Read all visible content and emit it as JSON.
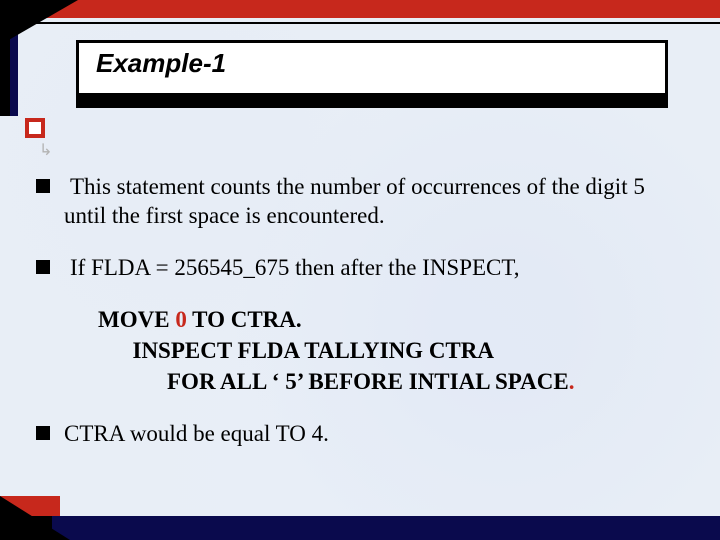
{
  "title": "Example-1",
  "bullets": {
    "b1": "This statement counts the number of occurrences of the digit 5 until the first space is encountered.",
    "b2_prefix": "If   FLDA = 256545_675  then after the INSPECT,",
    "b3": "CTRA would be equal TO 4."
  },
  "code": {
    "line1_a": "MOVE ",
    "line1_num": "0",
    "line1_b": " TO CTRA.",
    "line2": "      INSPECT FLDA TALLYING CTRA",
    "line3_a": "            FOR ALL ‘ 5’ BEFORE INTIAL SPACE",
    "line3_dot": "."
  },
  "glyphs": {
    "arrow": "↳"
  }
}
